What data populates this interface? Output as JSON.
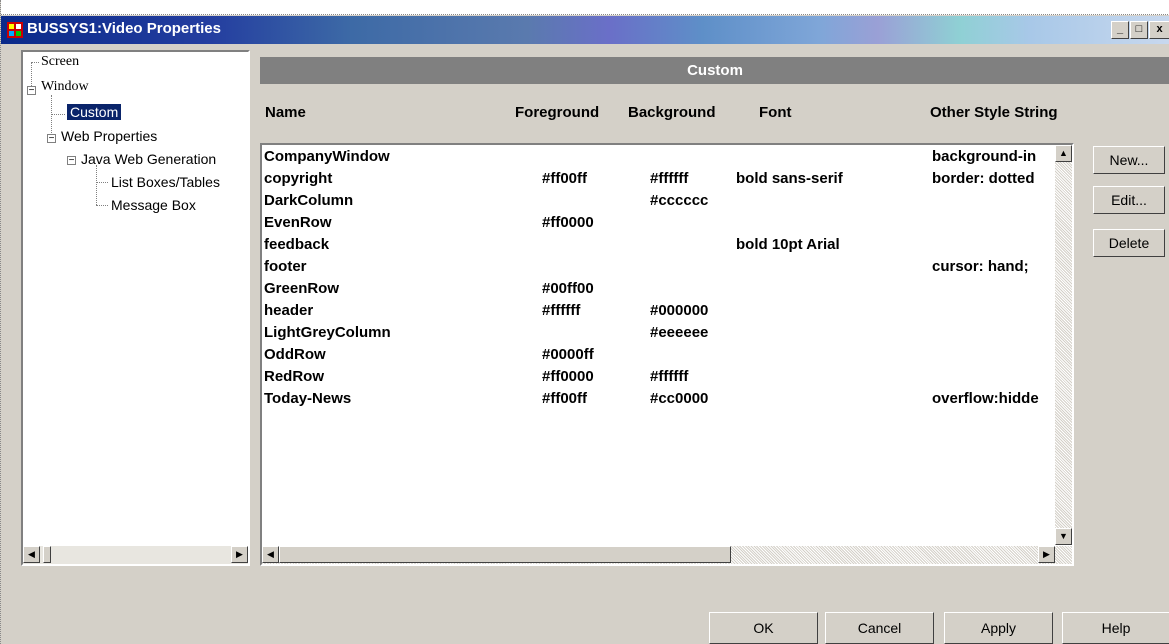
{
  "window": {
    "title": "BUSSYS1:Video Properties",
    "controls": [
      "_",
      "□",
      "x"
    ]
  },
  "tree": {
    "items": [
      {
        "label": "Screen"
      },
      {
        "label": "Window"
      },
      {
        "label": "Custom",
        "selected": true
      },
      {
        "label": "Web Properties"
      },
      {
        "label": "Java Web Generation"
      },
      {
        "label": "List Boxes/Tables"
      },
      {
        "label": "Message Box"
      }
    ]
  },
  "panel": {
    "title": "Custom",
    "columns": [
      "Name",
      "Foreground",
      "Background",
      "Font",
      "Other Style String"
    ]
  },
  "rows": [
    {
      "name": "CompanyWindow",
      "fg": "",
      "bg": "",
      "font": "",
      "other": "background-in"
    },
    {
      "name": "copyright",
      "fg": "#ff00ff",
      "bg": "#ffffff",
      "font": "bold sans-serif",
      "other": "border: dotted"
    },
    {
      "name": "DarkColumn",
      "fg": "",
      "bg": "#cccccc",
      "font": "",
      "other": ""
    },
    {
      "name": "EvenRow",
      "fg": "#ff0000",
      "bg": "",
      "font": "",
      "other": ""
    },
    {
      "name": "feedback",
      "fg": "",
      "bg": "",
      "font": "bold  10pt  Arial",
      "other": ""
    },
    {
      "name": "footer",
      "fg": "",
      "bg": "",
      "font": "",
      "other": "cursor: hand;"
    },
    {
      "name": "GreenRow",
      "fg": "#00ff00",
      "bg": "",
      "font": "",
      "other": ""
    },
    {
      "name": "header",
      "fg": "#ffffff",
      "bg": "#000000",
      "font": "",
      "other": ""
    },
    {
      "name": "LightGreyColumn",
      "fg": "",
      "bg": "#eeeeee",
      "font": "",
      "other": ""
    },
    {
      "name": "OddRow",
      "fg": "#0000ff",
      "bg": "",
      "font": "",
      "other": ""
    },
    {
      "name": "RedRow",
      "fg": "#ff0000",
      "bg": "#ffffff",
      "font": "",
      "other": ""
    },
    {
      "name": "Today-News",
      "fg": "#ff00ff",
      "bg": "#cc0000",
      "font": "",
      "other": "overflow:hidde"
    }
  ],
  "side_buttons": {
    "new": "New...",
    "edit": "Edit...",
    "delete": "Delete"
  },
  "footer_buttons": {
    "ok": "OK",
    "cancel": "Cancel",
    "apply": "Apply",
    "help": "Help"
  },
  "colors": {
    "selection": "#0a246a",
    "panel_header": "#808080",
    "face": "#d4d0c8"
  }
}
